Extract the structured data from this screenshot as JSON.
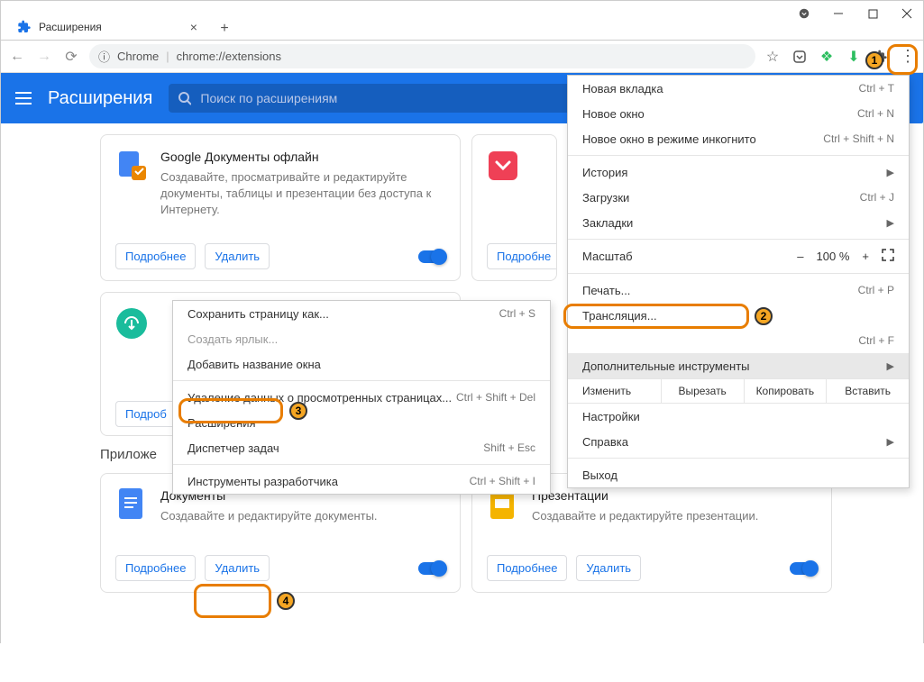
{
  "window": {
    "tab_title": "Расширения",
    "address_label": "Chrome",
    "address_url": "chrome://extensions"
  },
  "header": {
    "title": "Расширения",
    "search_placeholder": "Поиск по расширениям"
  },
  "cards": {
    "gdocs": {
      "title": "Google Документы офлайн",
      "desc": "Создавайте, просматривайте и редактируйте документы, таблицы и презентации без доступа к Интернету.",
      "more": "Подробнее",
      "remove": "Удалить"
    },
    "pocket": {
      "more": "Подробне"
    },
    "skyload": {
      "more": "Подроб"
    },
    "docs": {
      "title": "Документы",
      "desc": "Создавайте и редактируйте документы.",
      "more": "Подробнее",
      "remove": "Удалить"
    },
    "slides": {
      "title": "Презентации",
      "desc": "Создавайте и редактируйте презентации.",
      "more": "Подробнее",
      "remove": "Удалить"
    }
  },
  "section_apps": "Приложе",
  "main_menu": {
    "new_tab": {
      "label": "Новая вкладка",
      "shortcut": "Ctrl + T"
    },
    "new_window": {
      "label": "Новое окно",
      "shortcut": "Ctrl + N"
    },
    "incognito": {
      "label": "Новое окно в режиме инкогнито",
      "shortcut": "Ctrl + Shift + N"
    },
    "history": {
      "label": "История"
    },
    "downloads": {
      "label": "Загрузки",
      "shortcut": "Ctrl + J"
    },
    "bookmarks": {
      "label": "Закладки"
    },
    "zoom_label": "Масштаб",
    "zoom_value": "100 %",
    "print": {
      "label": "Печать...",
      "shortcut": "Ctrl + P"
    },
    "cast": {
      "label": "Трансляция..."
    },
    "find": {
      "shortcut": "Ctrl + F"
    },
    "more_tools": {
      "label": "Дополнительные инструменты"
    },
    "edit_label": "Изменить",
    "cut": "Вырезать",
    "copy": "Копировать",
    "paste": "Вставить",
    "settings": {
      "label": "Настройки"
    },
    "help": {
      "label": "Справка"
    },
    "exit": {
      "label": "Выход"
    }
  },
  "sub_menu": {
    "save_page": {
      "label": "Сохранить страницу как...",
      "shortcut": "Ctrl + S"
    },
    "shortcut": {
      "label": "Создать ярлык..."
    },
    "name_window": {
      "label": "Добавить название окна"
    },
    "clear_data": {
      "label": "Удаление данных о просмотренных страницах...",
      "shortcut": "Ctrl + Shift + Del"
    },
    "extensions": {
      "label": "Расширения"
    },
    "task_mgr": {
      "label": "Диспетчер задач",
      "shortcut": "Shift + Esc"
    },
    "dev_tools": {
      "label": "Инструменты разработчика",
      "shortcut": "Ctrl + Shift + I"
    }
  },
  "badges": {
    "b1": "1",
    "b2": "2",
    "b3": "3",
    "b4": "4"
  }
}
